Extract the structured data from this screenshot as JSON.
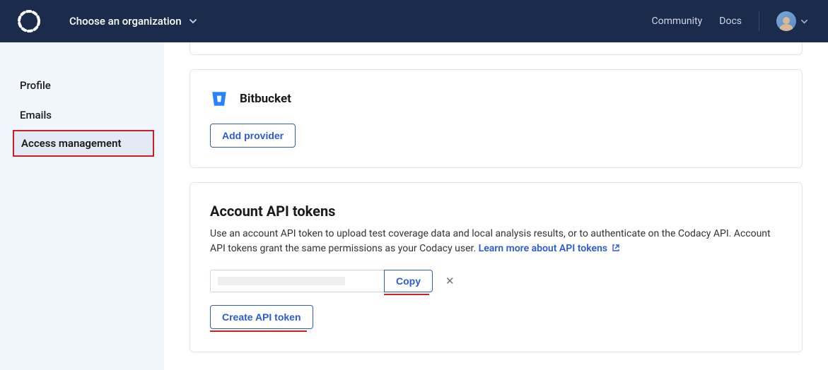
{
  "header": {
    "org_selector_label": "Choose an organization",
    "links": {
      "community": "Community",
      "docs": "Docs"
    }
  },
  "sidebar": {
    "items": [
      {
        "label": "Profile"
      },
      {
        "label": "Emails"
      },
      {
        "label": "Access management"
      }
    ]
  },
  "providers": {
    "bitbucket": {
      "name": "Bitbucket",
      "add_label": "Add provider"
    }
  },
  "tokens": {
    "title": "Account API tokens",
    "description_1": "Use an account API token to upload test coverage data and local analysis results, or to authenticate on the Codacy API. Account API tokens grant the same permissions as your Codacy user.",
    "learn_more_label": "Learn more about API tokens",
    "copy_label": "Copy",
    "create_label": "Create API token"
  },
  "colors": {
    "header_bg": "#1a2b4c",
    "sidebar_bg": "#f1f5fc",
    "primary": "#2a5bd7",
    "highlight": "#cc2020"
  }
}
